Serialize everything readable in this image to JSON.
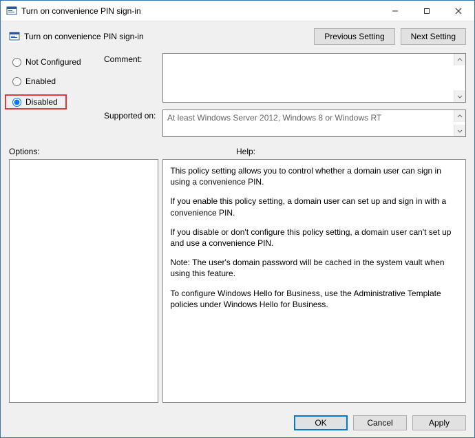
{
  "window": {
    "title": "Turn on convenience PIN sign-in"
  },
  "header": {
    "title": "Turn on convenience PIN sign-in",
    "prev_label": "Previous Setting",
    "next_label": "Next Setting"
  },
  "radios": {
    "not_configured": "Not Configured",
    "enabled": "Enabled",
    "disabled": "Disabled",
    "selected": "disabled"
  },
  "fields": {
    "comment_label": "Comment:",
    "comment_value": "",
    "supported_label": "Supported on:",
    "supported_value": "At least Windows Server 2012, Windows 8 or Windows RT"
  },
  "middle": {
    "options_label": "Options:",
    "help_label": "Help:"
  },
  "help_paragraphs": [
    "This policy setting allows you to control whether a domain user can sign in using a convenience PIN.",
    "If you enable this policy setting, a domain user can set up and sign in with a convenience PIN.",
    "If you disable or don't configure this policy setting, a domain user can't set up and use a convenience PIN.",
    "Note: The user's domain password will be cached in the system vault when using this feature.",
    "To configure Windows Hello for Business, use the Administrative Template policies under Windows Hello for Business."
  ],
  "buttons": {
    "ok": "OK",
    "cancel": "Cancel",
    "apply": "Apply"
  }
}
